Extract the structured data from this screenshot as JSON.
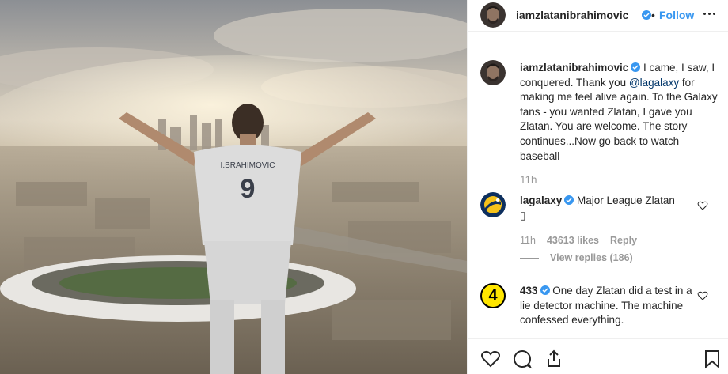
{
  "header": {
    "username": "iamzlatanibrahimovic",
    "separator": "•",
    "follow_label": "Follow"
  },
  "photo": {
    "jersey_number": "9",
    "jersey_name": "I.BRAHIMOVIC"
  },
  "caption": {
    "username": "iamzlatanibrahimovic",
    "text_before": " I came, I saw, I conquered. Thank you ",
    "mention": "@lagalaxy",
    "text_after": " for making me feel alive again. To the Galaxy fans - you wanted Zlatan, I gave you Zlatan. You are welcome. The story continues...Now go back to watch baseball",
    "time": "11h"
  },
  "comments": [
    {
      "username": "lagalaxy",
      "text": " Major League Zlatan",
      "extra": "▯",
      "time": "11h",
      "likes": "43613 likes",
      "reply": "Reply",
      "view_replies": "View replies (186)"
    },
    {
      "username": "433",
      "text": " One day Zlatan did a test in a lie detector machine. The machine confessed everything.",
      "avatar_text": "4"
    }
  ],
  "colors": {
    "link": "#3897f0",
    "mention": "#003569",
    "muted": "#999999",
    "verified": "#3897f0"
  },
  "icons": [
    "heart-icon",
    "comment-icon",
    "share-icon",
    "bookmark-icon",
    "verified-badge-icon",
    "more-options-icon"
  ]
}
